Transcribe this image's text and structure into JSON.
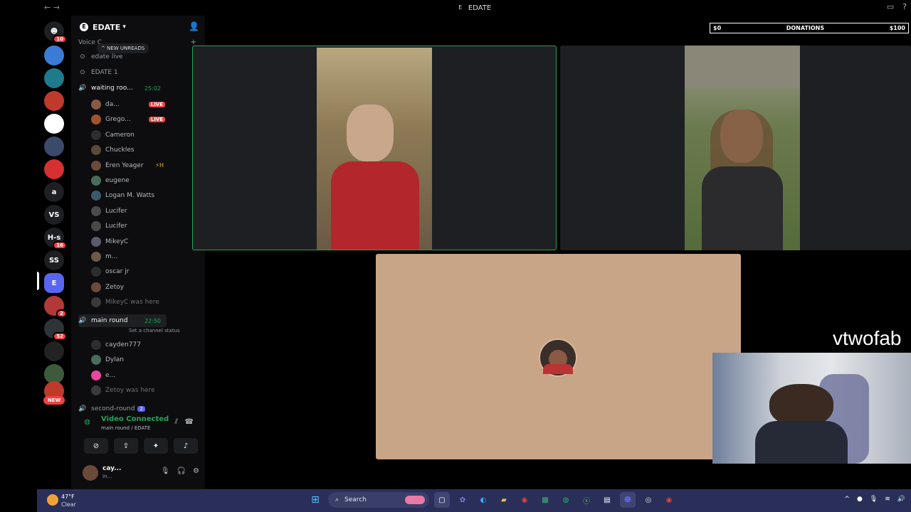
{
  "window": {
    "title": "EDATE",
    "title_logo": "E",
    "nav_icons": [
      "back-icon",
      "forward-icon"
    ],
    "right_icons": [
      "inbox-icon",
      "help-icon"
    ]
  },
  "rail": {
    "home_badge": "10",
    "servers": [
      {
        "name": "server-1",
        "color": "#3a7bd5"
      },
      {
        "name": "server-2",
        "color": "#1f7a8c"
      },
      {
        "name": "server-3",
        "color": "#c0392b"
      },
      {
        "name": "server-4",
        "color": "#ffffff"
      },
      {
        "name": "server-5",
        "color": "#3b4a6b"
      },
      {
        "name": "server-6",
        "color": "#d63031"
      },
      {
        "name": "server-a",
        "label": "a",
        "color": "#1e1f22"
      },
      {
        "name": "server-vs",
        "label": "VS",
        "color": "#1e1f22"
      },
      {
        "name": "server-hs",
        "label": "H-s",
        "color": "#1e1f22",
        "badge": "16"
      },
      {
        "name": "server-ss",
        "label": "SS",
        "color": "#1e1f22"
      },
      {
        "name": "server-edate",
        "label": "E",
        "color": "#5865f2"
      },
      {
        "name": "server-7",
        "color": "#b33939",
        "badge": "2"
      },
      {
        "name": "server-8",
        "color": "#2d3436",
        "badge": "52"
      },
      {
        "name": "server-9",
        "color": "#222222"
      },
      {
        "name": "server-10",
        "color": "#3d5a3d"
      },
      {
        "name": "server-11",
        "color": "#c0392b"
      }
    ],
    "new_label": "NEW"
  },
  "guild": {
    "name": "EDATE",
    "chevron": "▾"
  },
  "sidebar": {
    "category": "Voice C",
    "new_unreads": "NEW UNREADS",
    "channels": [
      {
        "name": "edate live",
        "type": "stage"
      },
      {
        "name": "EDATE 1",
        "type": "stage"
      },
      {
        "name": "waiting roo...",
        "type": "voice",
        "time": "25:02",
        "active": true
      }
    ],
    "waiting_members": [
      {
        "name": "da...",
        "live": "LIVE",
        "color": "#8a5a44"
      },
      {
        "name": "Grego...",
        "live": "LIVE",
        "color": "#a0522d"
      },
      {
        "name": "Cameron",
        "color": "#2b2d31"
      },
      {
        "name": "Chuckles",
        "color": "#5a4a3a"
      },
      {
        "name": "Eren Yeager",
        "color": "#6b4a3a",
        "extra": "⚡H"
      },
      {
        "name": "eugene",
        "color": "#4a6b5a"
      },
      {
        "name": "Logan M. Watts",
        "color": "#3a5a6b"
      },
      {
        "name": "Lucifer",
        "color": "#4a4a4a"
      },
      {
        "name": "Lucifer",
        "color": "#4a4a4a"
      },
      {
        "name": "MikeyC",
        "color": "#5a5a6b"
      },
      {
        "name": "m...",
        "color": "#6b5a4a"
      },
      {
        "name": "oscar jr",
        "color": "#2b2d31"
      },
      {
        "name": "Zetoy",
        "color": "#6b4a3a"
      },
      {
        "name": "MikeyC was here",
        "color": "#3a3a3a",
        "dim": true
      }
    ],
    "main_round": {
      "name": "main round",
      "time": "22:50",
      "status": "Set a channel status"
    },
    "main_members": [
      {
        "name": "cayden777",
        "color": "#2b2d31"
      },
      {
        "name": "Dylan",
        "color": "#4a6b5a"
      },
      {
        "name": "e...",
        "color": "#eb459e"
      },
      {
        "name": "Zetoy was here",
        "color": "#3a3a3a",
        "dim": true
      }
    ],
    "next_channel": "second-round",
    "next_badge": "2"
  },
  "voice_panel": {
    "status": "Video Connected",
    "location": "main round / EDATE",
    "buttons": [
      "camera-off-icon",
      "screen-share-icon",
      "activities-icon",
      "soundboard-icon"
    ]
  },
  "user_panel": {
    "name": "cay...",
    "status": "In..."
  },
  "stage": {
    "donations": {
      "left": "$0",
      "center": "DONATIONS",
      "right": "$100"
    },
    "brand": "vtwofab"
  },
  "taskbar": {
    "temp": "47°F",
    "condition": "Clear",
    "search": "Search"
  }
}
